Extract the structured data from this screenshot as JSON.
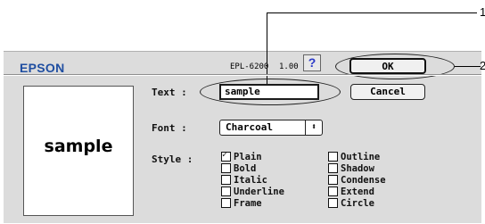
{
  "dialog": {
    "logo": "EPSON",
    "printer_model": "EPL-6200",
    "version": "1.00",
    "help_label": "?",
    "ok_label": "OK",
    "cancel_label": "Cancel"
  },
  "form": {
    "text_label": "Text :",
    "text_value": "sample",
    "font_label": "Font :",
    "font_value": "Charcoal",
    "style_label": "Style :"
  },
  "preview": {
    "text": "sample"
  },
  "styles": [
    {
      "label": "Plain",
      "checked": true
    },
    {
      "label": "Bold",
      "checked": false
    },
    {
      "label": "Italic",
      "checked": false
    },
    {
      "label": "Underline",
      "checked": false
    },
    {
      "label": "Frame",
      "checked": false
    },
    {
      "label": "Outline",
      "checked": false
    },
    {
      "label": "Shadow",
      "checked": false
    },
    {
      "label": "Condense",
      "checked": false
    },
    {
      "label": "Extend",
      "checked": false
    },
    {
      "label": "Circle",
      "checked": false
    }
  ],
  "callouts": [
    "1",
    "2"
  ]
}
